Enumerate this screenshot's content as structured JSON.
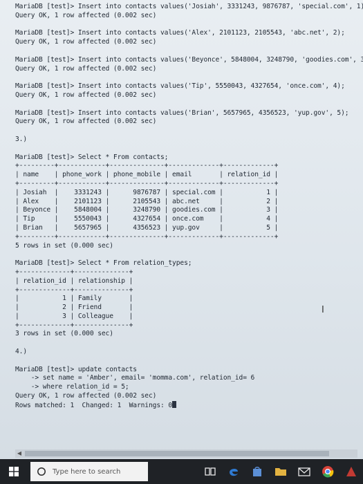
{
  "terminal": {
    "lines": [
      "MariaDB [test]> Insert into contacts values('Josiah', 3331243, 9876787, 'special.com', 1);",
      "Query OK, 1 row affected (0.002 sec)",
      "",
      "MariaDB [test]> Insert into contacts values('Alex', 2101123, 2105543, 'abc.net', 2);",
      "Query OK, 1 row affected (0.002 sec)",
      "",
      "MariaDB [test]> Insert into contacts values('Beyonce', 5848004, 3248790, 'goodies.com', 3);",
      "Query OK, 1 row affected (0.002 sec)",
      "",
      "MariaDB [test]> Insert into contacts values('Tip', 5550043, 4327654, 'once.com', 4);",
      "Query OK, 1 row affected (0.002 sec)",
      "",
      "MariaDB [test]> Insert into contacts values('Brian', 5657965, 4356523, 'yup.gov', 5);",
      "Query OK, 1 row affected (0.002 sec)",
      "",
      "3.)",
      "",
      "MariaDB [test]> Select * From contacts;",
      "+---------+------------+--------------+-------------+-------------+",
      "| name    | phone_work | phone_mobile | email       | relation_id |",
      "+---------+------------+--------------+-------------+-------------+",
      "| Josiah  |    3331243 |      9876787 | special.com |           1 |",
      "| Alex    |    2101123 |      2105543 | abc.net     |           2 |",
      "| Beyonce |    5848004 |      3248790 | goodies.com |           3 |",
      "| Tip     |    5550043 |      4327654 | once.com    |           4 |",
      "| Brian   |    5657965 |      4356523 | yup.gov     |           5 |",
      "+---------+------------+--------------+-------------+-------------+",
      "5 rows in set (0.000 sec)",
      "",
      "MariaDB [test]> Select * From relation_types;",
      "+-------------+--------------+",
      "| relation_id | relationship |",
      "+-------------+--------------+",
      "|           1 | Family       |",
      "|           2 | Friend       |",
      "|           3 | Colleague    |",
      "+-------------+--------------+",
      "3 rows in set (0.000 sec)",
      "",
      "4.)",
      "",
      "MariaDB [test]> update contacts",
      "    -> set name = 'Amber', email= 'momma.com', relation_id= 6",
      "    -> where relation_id = 5;",
      "Query OK, 1 row affected (0.002 sec)",
      "Rows matched: 1  Changed: 1  Warnings: 0"
    ]
  },
  "taskbar": {
    "search_placeholder": "Type here to search"
  },
  "icons": {
    "start": "windows-logo-icon",
    "search": "search-circle-icon",
    "task_view": "task-view-icon",
    "edge": "edge-browser-icon",
    "store": "store-icon",
    "folder": "file-explorer-icon",
    "mail": "mail-icon",
    "chrome": "chrome-icon",
    "app": "app-icon"
  },
  "colors": {
    "taskbar": "#1f2226",
    "edge": "#2f7ad1",
    "folder": "#e3b341",
    "terminal_text": "#222a35"
  }
}
